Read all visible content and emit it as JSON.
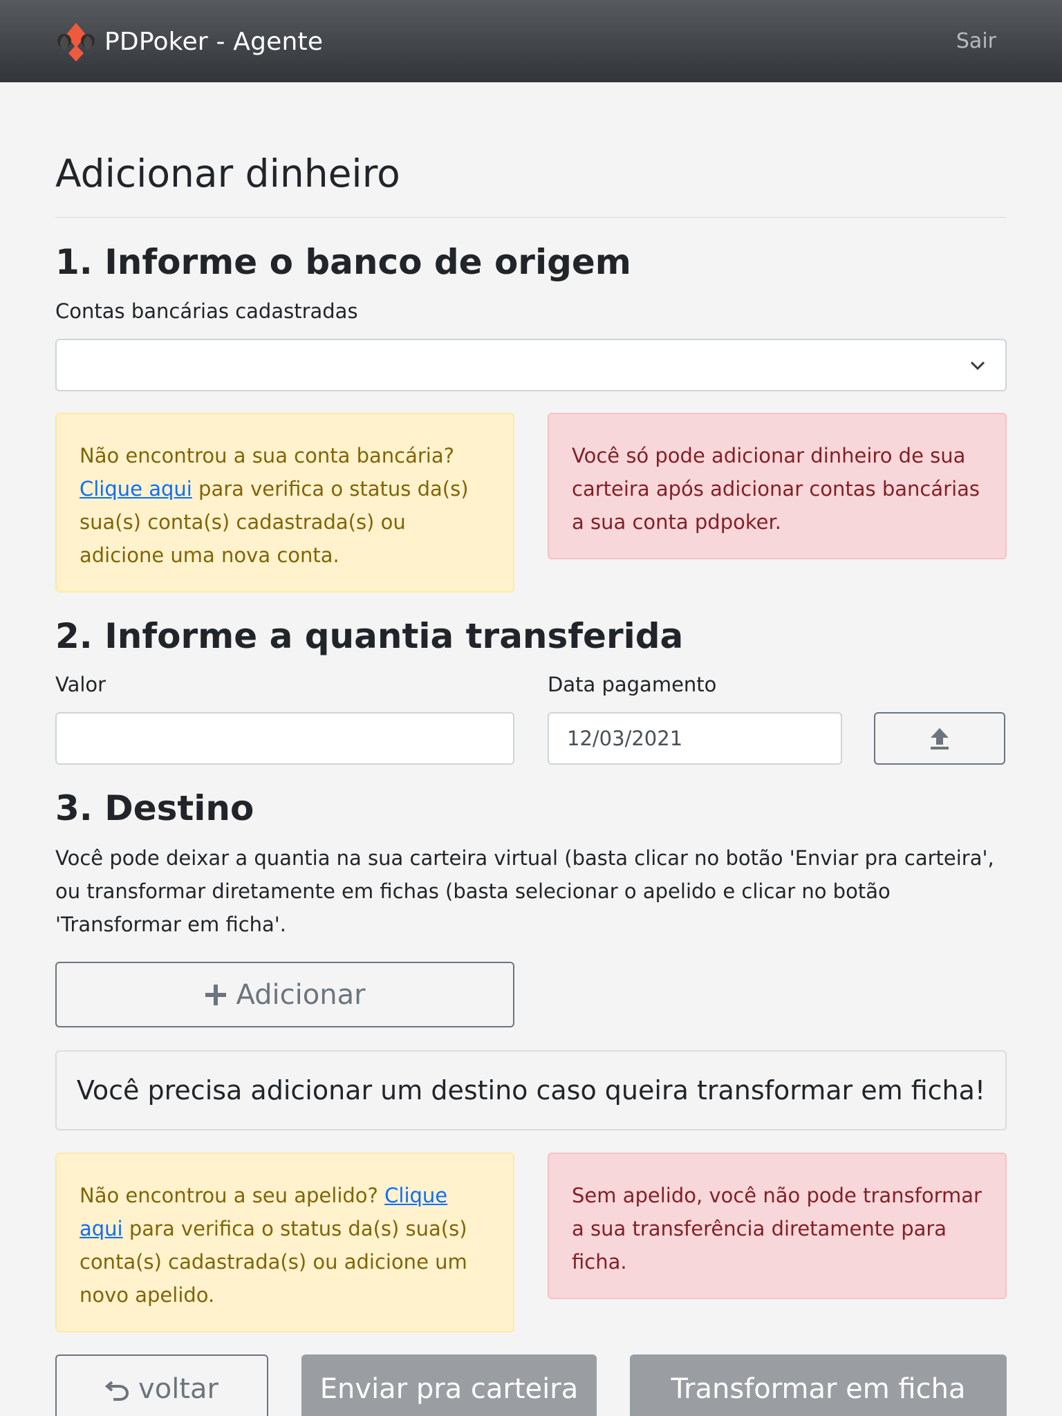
{
  "header": {
    "brand": "PDPoker - Agente",
    "logout": "Sair",
    "logo_icon": "cards-suits-logo-icon"
  },
  "page": {
    "title": "Adicionar dinheiro"
  },
  "section1": {
    "heading": "1. Informe o banco de origem",
    "select_label": "Contas bancárias cadastradas",
    "select_value": "",
    "warning_text_before": "Não encontrou a sua conta bancária?",
    "warning_link": "Clique aqui",
    "warning_text_after": "para verifica o status da(s) sua(s) conta(s) cadastrada(s) ou adicione uma nova conta.",
    "danger_text": "Você só pode adicionar dinheiro de sua carteira após adicionar contas bancárias a sua conta pdpoker."
  },
  "section2": {
    "heading": "2. Informe a quantia transferida",
    "value_label": "Valor",
    "value_input": "",
    "date_label": "Data pagamento",
    "date_value": "12/03/2021",
    "upload_icon": "upload-icon"
  },
  "section3": {
    "heading": "3. Destino",
    "description": "Você pode deixar a quantia na sua carteira virtual (basta clicar no botão 'Enviar pra carteira', ou transformar diretamente em fichas (basta selecionar o apelido e clicar no botão 'Transformar em ficha'.",
    "add_button": "Adicionar",
    "notice": "Você precisa adicionar um destino caso queira transformar em ficha!",
    "warning_text_before": "Não encontrou a seu apelido?",
    "warning_link": "Clique aqui",
    "warning_text_after": "para verifica o status da(s) sua(s) conta(s) cadastrada(s) ou adicione um novo apelido.",
    "danger_text": "Sem apelido, você não pode transformar a sua transferência diretamente para ficha."
  },
  "footer_buttons": {
    "back": "voltar",
    "send_wallet": "Enviar pra carteira",
    "transform": "Transformar em ficha"
  },
  "colors": {
    "navbar": "#3d4145",
    "warning_bg": "#fff2cd",
    "danger_bg": "#f8d7da",
    "link": "#0d6efd",
    "disabled_button": "#9a9ea3"
  }
}
